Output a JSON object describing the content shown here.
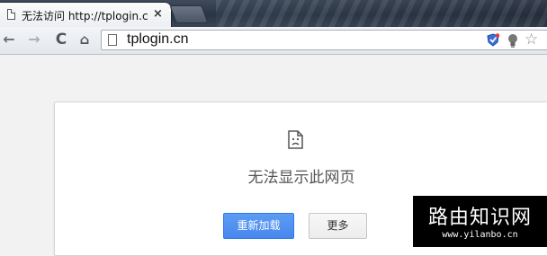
{
  "tab": {
    "title": "无法访问 http://tplogin.c",
    "close_glyph": "×"
  },
  "toolbar": {
    "back_glyph": "←",
    "forward_glyph": "→",
    "reload_glyph": "C",
    "home_glyph": "⌂",
    "url": "tplogin.cn",
    "star_glyph": "☆"
  },
  "error_page": {
    "title": "无法显示此网页",
    "reload_button": "重新加载",
    "more_button": "更多"
  },
  "colors": {
    "primary_button": "#4d90fe",
    "shield": "#3a6fd8"
  },
  "watermark": {
    "main": "路由知识网",
    "sub": "www.yilanbo.cn"
  }
}
